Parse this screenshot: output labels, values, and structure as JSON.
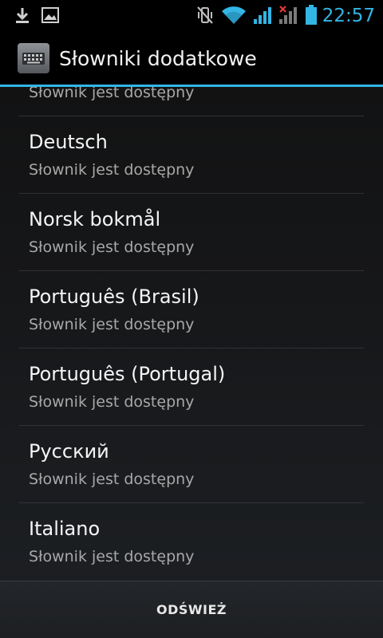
{
  "status_bar": {
    "time": "22:57",
    "icons": [
      "download-icon",
      "image-icon",
      "vibrate-muted-icon",
      "wifi-icon",
      "signal-icon",
      "signal-no-service-icon",
      "battery-icon"
    ]
  },
  "colors": {
    "accent": "#33b5e5"
  },
  "action_bar": {
    "title": "Słowniki dodatkowe",
    "icon": "keyboard-icon"
  },
  "list": {
    "items": [
      {
        "title": "",
        "subtitle": "Słownik jest dostępny"
      },
      {
        "title": "Deutsch",
        "subtitle": "Słownik jest dostępny"
      },
      {
        "title": "Norsk bokmål",
        "subtitle": "Słownik jest dostępny"
      },
      {
        "title": "Português (Brasil)",
        "subtitle": "Słownik jest dostępny"
      },
      {
        "title": "Português (Portugal)",
        "subtitle": "Słownik jest dostępny"
      },
      {
        "title": "Русский",
        "subtitle": "Słownik jest dostępny"
      },
      {
        "title": "Italiano",
        "subtitle": "Słownik jest dostępny"
      }
    ]
  },
  "footer": {
    "refresh_label": "ODŚWIEŻ"
  }
}
